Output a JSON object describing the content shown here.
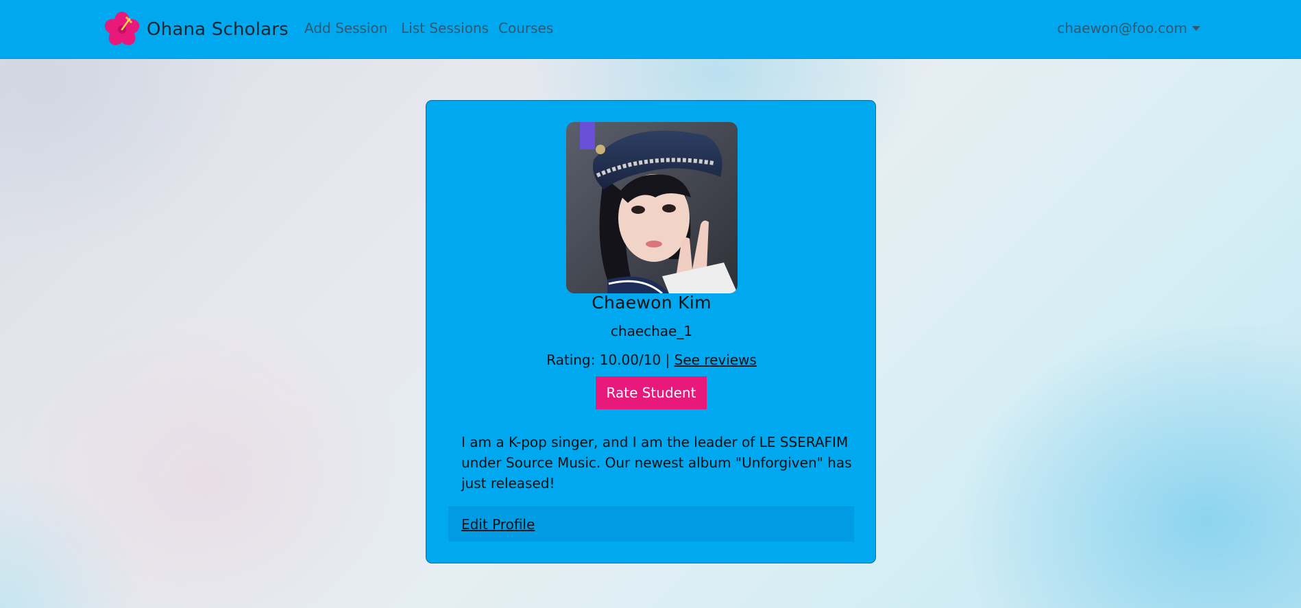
{
  "navbar": {
    "brand": "Ohana Scholars",
    "brand_icon": "hibiscus-icon",
    "links": [
      "Add Session",
      "List Sessions",
      "Courses"
    ],
    "user_email": "chaewon@foo.com"
  },
  "profile": {
    "name": "Chaewon Kim",
    "username": "chaechae_1",
    "rating_text": "Rating: 10.00/10 |",
    "reviews_link": "See reviews",
    "rate_button": "Rate Student",
    "bio": "I am a K-pop singer, and I am the leader of LE SSERAFIM under Source Music. Our newest album \"Unforgiven\" has just released!",
    "edit_link": "Edit Profile"
  },
  "colors": {
    "navbar": "#00a8ef",
    "card": "#00a8ef",
    "accent_button": "#e8197b"
  }
}
